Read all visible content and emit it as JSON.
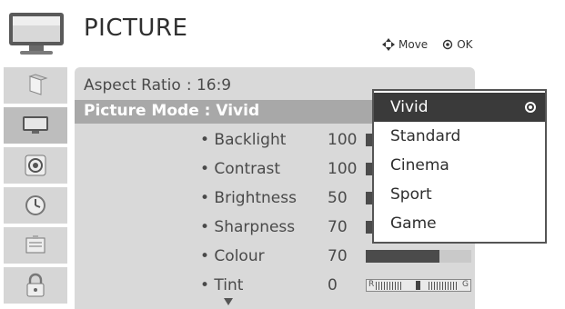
{
  "header": {
    "title": "PICTURE",
    "move_label": "Move",
    "ok_label": "OK"
  },
  "sidebar": {
    "items": [
      {
        "icon": "picture-aspect-icon"
      },
      {
        "icon": "tv-screen-icon"
      },
      {
        "icon": "audio-speaker-icon"
      },
      {
        "icon": "clock-icon"
      },
      {
        "icon": "option-box-icon"
      },
      {
        "icon": "lock-icon"
      }
    ]
  },
  "main": {
    "aspect_ratio": {
      "label": "Aspect Ratio",
      "value": ": 16:9"
    },
    "picture_mode": {
      "text": "Picture Mode : Vivid"
    },
    "settings": [
      {
        "label": "• Backlight",
        "value": "100",
        "level": 1.0
      },
      {
        "label": "• Contrast",
        "value": "100",
        "level": 1.0
      },
      {
        "label": "• Brightness",
        "value": "50",
        "level": 0.5
      },
      {
        "label": "• Sharpness",
        "value": "70",
        "level": 0.7
      },
      {
        "label": "• Colour",
        "value": "70",
        "level": 0.7
      },
      {
        "label": "• Tint",
        "value": "0",
        "tint_left": "R",
        "tint_right": "G"
      }
    ]
  },
  "dropdown": {
    "options": [
      "Vivid",
      "Standard",
      "Cinema",
      "Sport",
      "Game"
    ],
    "selected": "Vivid"
  }
}
